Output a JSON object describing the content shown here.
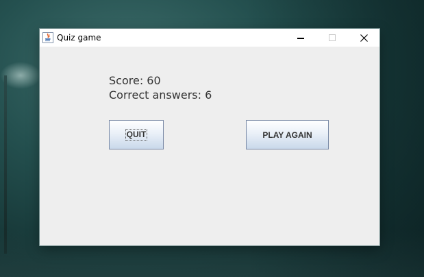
{
  "window": {
    "title": "Quiz game",
    "icon": "java-icon",
    "controls": {
      "minimize": "minimize-icon",
      "maximize": "maximize-icon",
      "close": "close-icon"
    }
  },
  "results": {
    "score_text": "Score: 60",
    "correct_text": "Correct answers: 6"
  },
  "buttons": {
    "quit_label": "QUIT",
    "play_again_label": "PLAY AGAIN"
  },
  "colors": {
    "window_bg": "#eeeeee",
    "titlebar_bg": "#ffffff",
    "button_border": "#7a8aa6",
    "text": "#333333"
  }
}
